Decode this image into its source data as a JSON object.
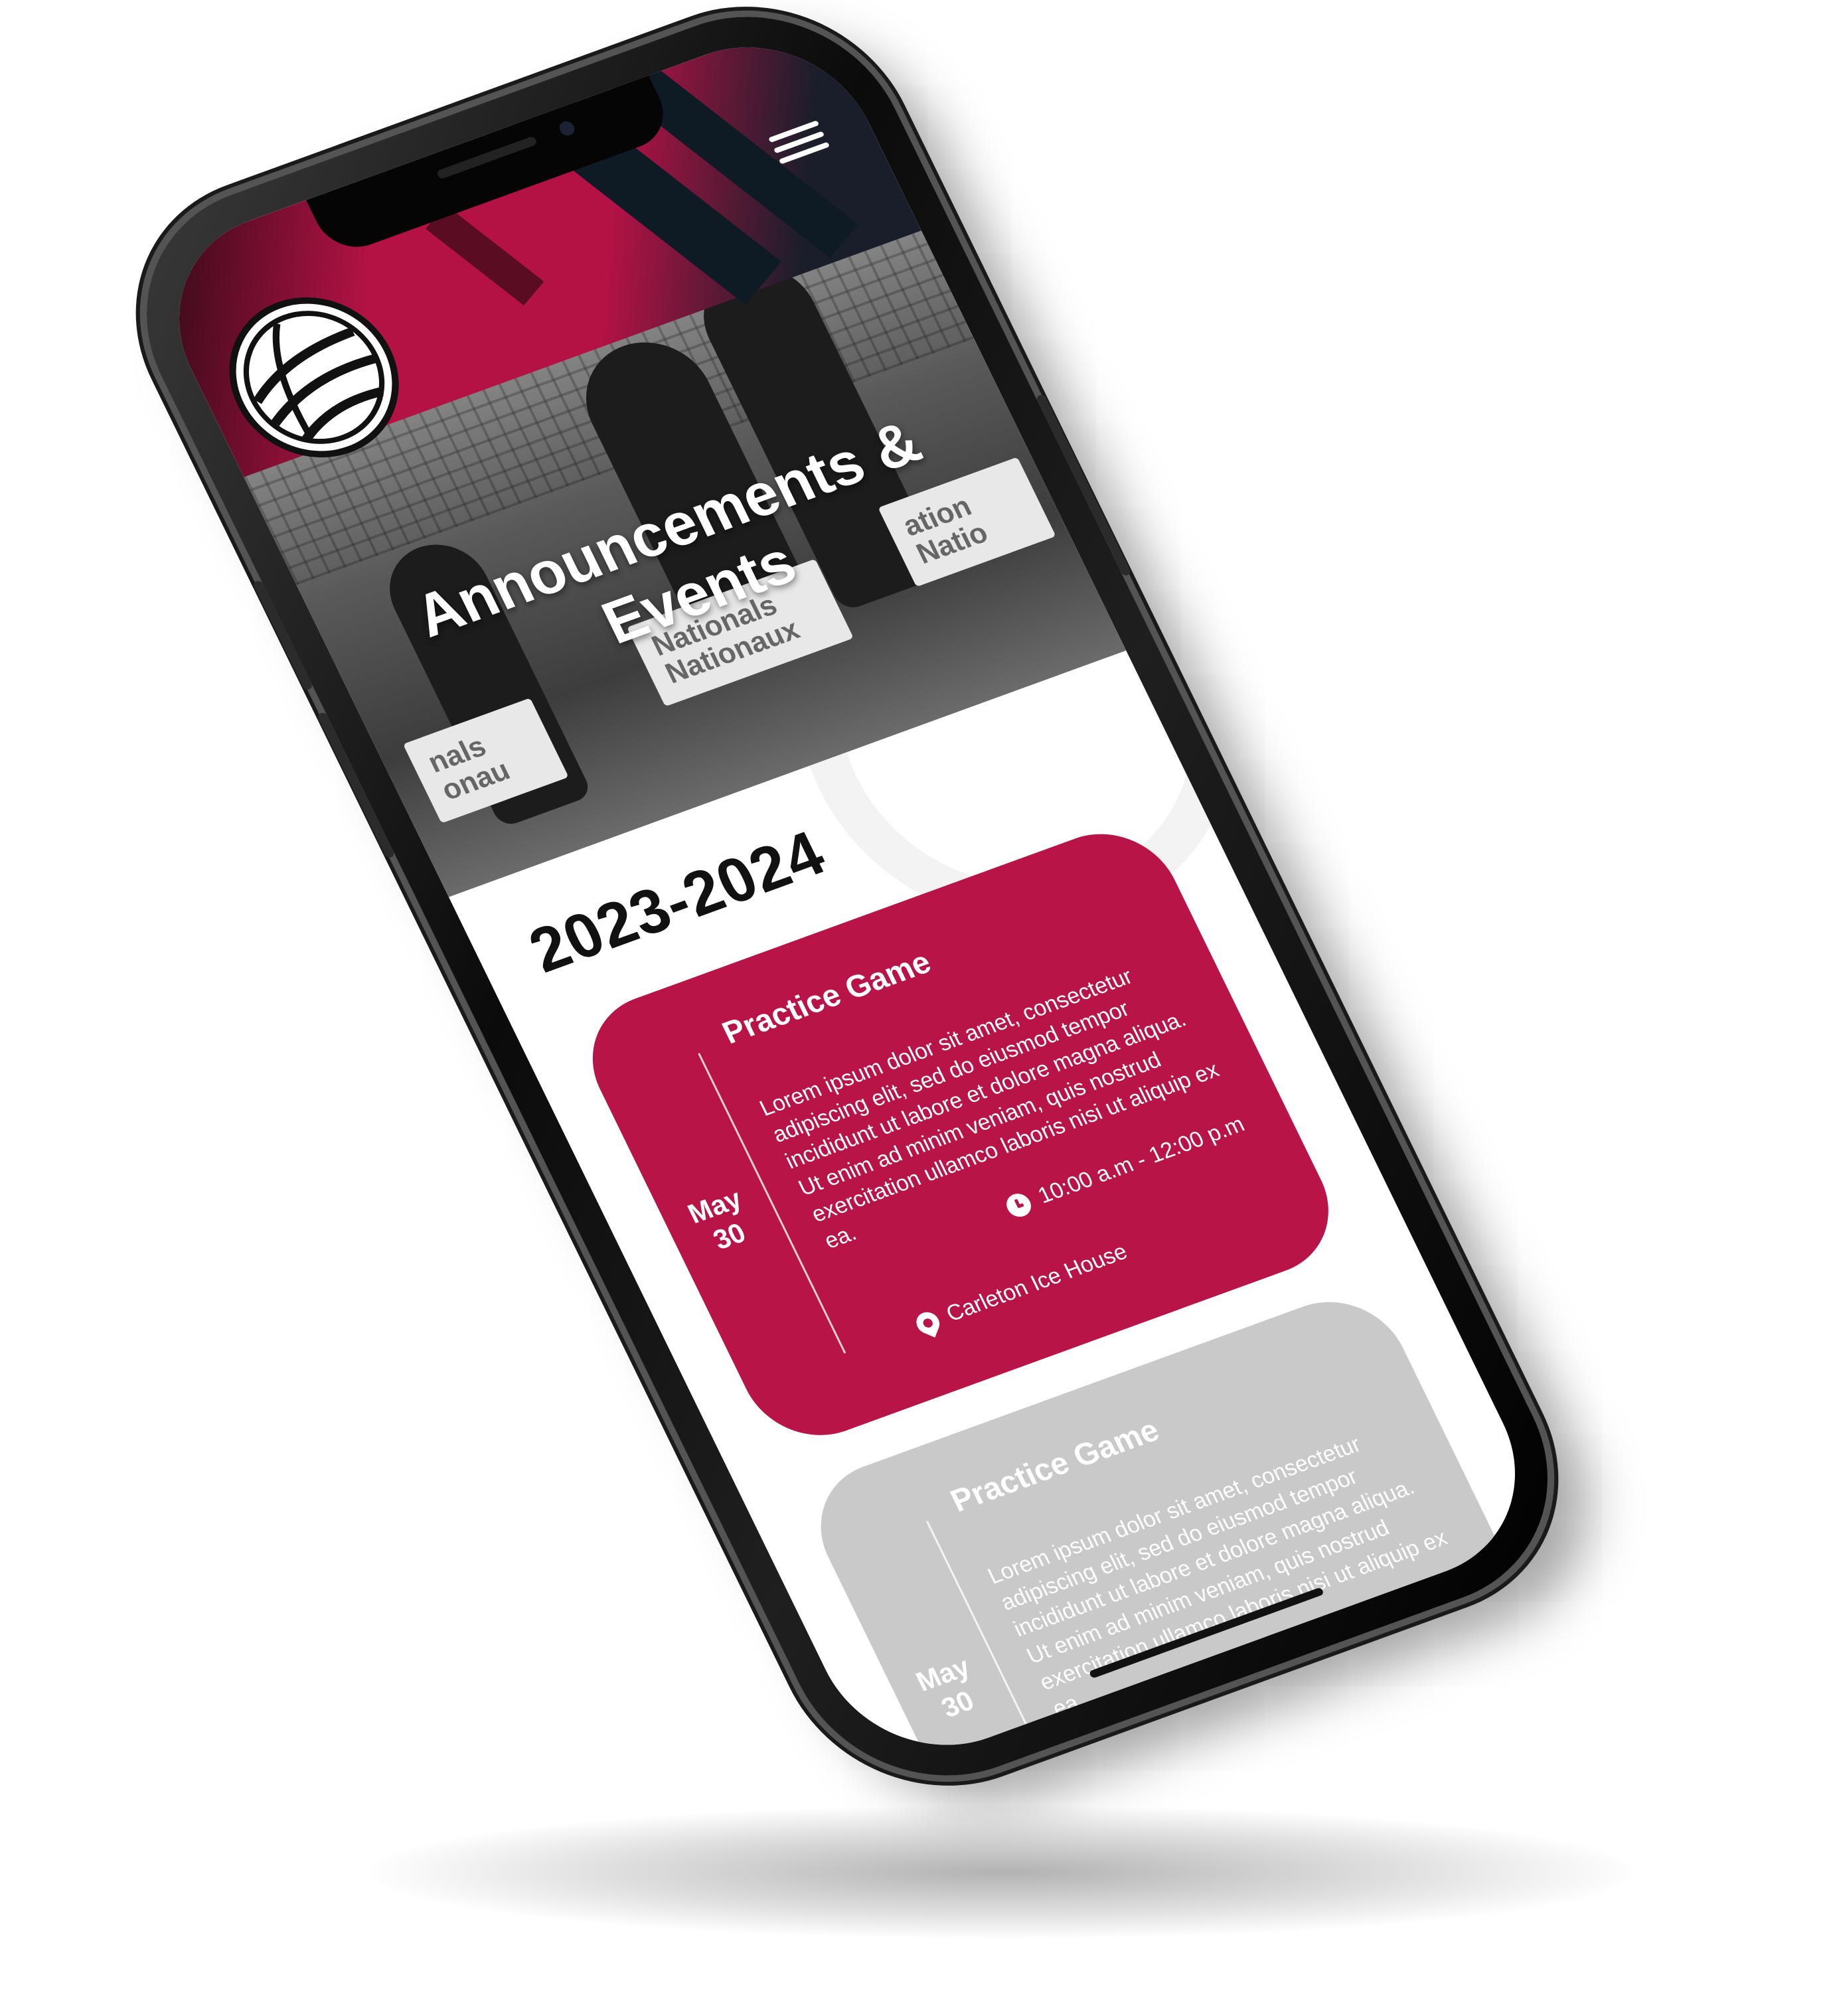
{
  "hero": {
    "title_line1": "Announcements &",
    "title_line2": "Events",
    "banner_text_1": "Nationals\nNationaux",
    "banner_text_2": "nals\nonau",
    "banner_text_3": "ation\nNatio"
  },
  "header": {
    "logo_icon": "volleyball-logo-icon",
    "menu_icon": "hamburger-menu-icon"
  },
  "section": {
    "season": "2023-2024"
  },
  "events": [
    {
      "date_month": "May",
      "date_day": "30",
      "title": "Practice Game",
      "description": "Lorem ipsum dolor sit amet, consectetur adipiscing elit, sed do eiusmod tempor incididunt ut labore et dolore magna aliqua. Ut enim ad minim veniam, quis nostrud exercitation ullamco laboris nisi ut aliquip ex ea.",
      "time": "10:00 a.m - 12:00 p.m",
      "location": "Carleton Ice House"
    },
    {
      "date_month": "May",
      "date_day": "30",
      "title": "Practice Game",
      "description": "Lorem ipsum dolor sit amet, consectetur adipiscing elit, sed do eiusmod tempor incididunt ut labore et dolore magna aliqua. Ut enim ad minim veniam, quis nostrud exercitation ullamco laboris nisi ut aliquip ex ea."
    }
  ],
  "colors": {
    "accent": "#b81448",
    "muted_card": "#c9c9c9",
    "dark": "#0e1a24"
  }
}
